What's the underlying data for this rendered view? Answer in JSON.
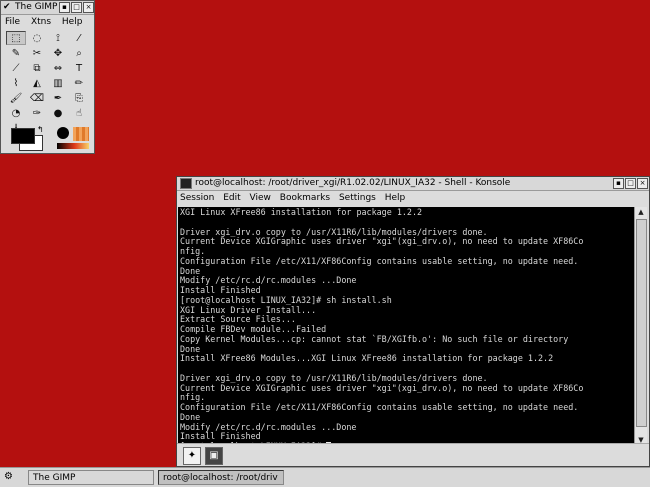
{
  "gimp": {
    "title": "The GIMP",
    "menu": [
      "File",
      "Xtns",
      "Help"
    ],
    "tools": [
      {
        "icon": "rect-select-icon",
        "glyph": "⬚",
        "selected": true
      },
      {
        "icon": "ellipse-select-icon",
        "glyph": "◌"
      },
      {
        "icon": "lasso-icon",
        "glyph": "⟟"
      },
      {
        "icon": "magic-wand-icon",
        "glyph": "⁄"
      },
      {
        "icon": "bezier-select-icon",
        "glyph": "✎"
      },
      {
        "icon": "scissors-icon",
        "glyph": "✂"
      },
      {
        "icon": "move-icon",
        "glyph": "✥"
      },
      {
        "icon": "magnify-icon",
        "glyph": "⌕"
      },
      {
        "icon": "crop-icon",
        "glyph": "⟋"
      },
      {
        "icon": "transform-icon",
        "glyph": "⧉"
      },
      {
        "icon": "flip-icon",
        "glyph": "⇔"
      },
      {
        "icon": "text-icon",
        "glyph": "T"
      },
      {
        "icon": "color-picker-icon",
        "glyph": "⌇"
      },
      {
        "icon": "bucket-fill-icon",
        "glyph": "◭"
      },
      {
        "icon": "blend-icon",
        "glyph": "▥"
      },
      {
        "icon": "pencil-icon",
        "glyph": "✏"
      },
      {
        "icon": "paintbrush-icon",
        "glyph": "🖌"
      },
      {
        "icon": "eraser-icon",
        "glyph": "⌫"
      },
      {
        "icon": "airbrush-icon",
        "glyph": "✒"
      },
      {
        "icon": "clone-icon",
        "glyph": "⎘"
      },
      {
        "icon": "convolve-icon",
        "glyph": "◔"
      },
      {
        "icon": "ink-icon",
        "glyph": "✑"
      },
      {
        "icon": "dodge-icon",
        "glyph": "●"
      },
      {
        "icon": "smudge-icon",
        "glyph": "☝"
      },
      {
        "icon": "measure-icon",
        "glyph": "⅄"
      }
    ]
  },
  "konsole": {
    "title": "root@localhost: /root/driver_xgi/R1.02.02/LINUX_IA32 - Shell - Konsole",
    "menu": [
      "Session",
      "Edit",
      "View",
      "Bookmarks",
      "Settings",
      "Help"
    ],
    "lines": [
      "XGI Linux XFree86 installation for package 1.2.2",
      "",
      "Driver xgi_drv.o copy to /usr/X11R6/lib/modules/drivers done.",
      "Current Device XGIGraphic uses driver \"xgi\"(xgi_drv.o), no need to update XF86Co",
      "nfig.",
      "Configuration File /etc/X11/XF86Config contains usable setting, no update need.",
      "Done",
      "Modify /etc/rc.d/rc.modules ...Done",
      "Install Finished",
      "[root@localhost LINUX_IA32]# sh install.sh",
      "XGI Linux Driver Install...",
      "Extract Source Files...",
      "Compile FBDev module...Failed",
      "Copy Kernel Modules...cp: cannot stat `FB/XGIfb.o': No such file or directory",
      "Done",
      "Install XFree86 Modules...XGI Linux XFree86 installation for package 1.2.2",
      "",
      "Driver xgi_drv.o copy to /usr/X11R6/lib/modules/drivers done.",
      "Current Device XGIGraphic uses driver \"xgi\"(xgi_drv.o), no need to update XF86Co",
      "nfig.",
      "Configuration File /etc/X11/XF86Config contains usable setting, no update need.",
      "Done",
      "Modify /etc/rc.d/rc.modules ...Done",
      "Install Finished"
    ],
    "prompt": "[root@localhost LINUX_IA32]# "
  },
  "taskbar": {
    "tasks": [
      {
        "label": "The GIMP",
        "active": false
      },
      {
        "label": "root@localhost: /root/driv",
        "active": true
      }
    ]
  }
}
